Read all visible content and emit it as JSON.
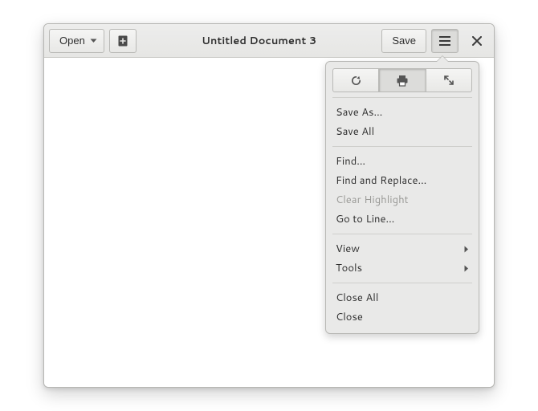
{
  "titlebar": {
    "open_label": "Open",
    "title": "Untitled Document 3",
    "save_label": "Save"
  },
  "menu": {
    "save_as": "Save As…",
    "save_all": "Save All",
    "find": "Find…",
    "find_replace": "Find and Replace…",
    "clear_highlight": "Clear Highlight",
    "go_to_line": "Go to Line…",
    "view": "View",
    "tools": "Tools",
    "close_all": "Close All",
    "close": "Close"
  }
}
